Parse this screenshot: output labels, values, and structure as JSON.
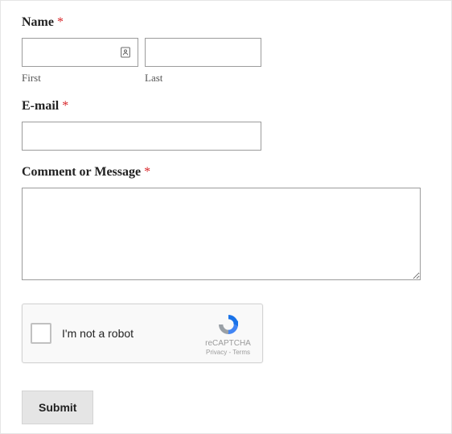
{
  "fields": {
    "name": {
      "label": "Name",
      "required_star": "*",
      "first": {
        "sub_label": "First",
        "value": ""
      },
      "last": {
        "sub_label": "Last",
        "value": ""
      }
    },
    "email": {
      "label": "E-mail",
      "required_star": "*",
      "value": ""
    },
    "comment": {
      "label": "Comment or Message",
      "required_star": "*",
      "value": ""
    }
  },
  "recaptcha": {
    "label": "I'm not a robot",
    "brand": "reCAPTCHA",
    "privacy": "Privacy",
    "separator": " - ",
    "terms": "Terms"
  },
  "submit_label": "Submit"
}
